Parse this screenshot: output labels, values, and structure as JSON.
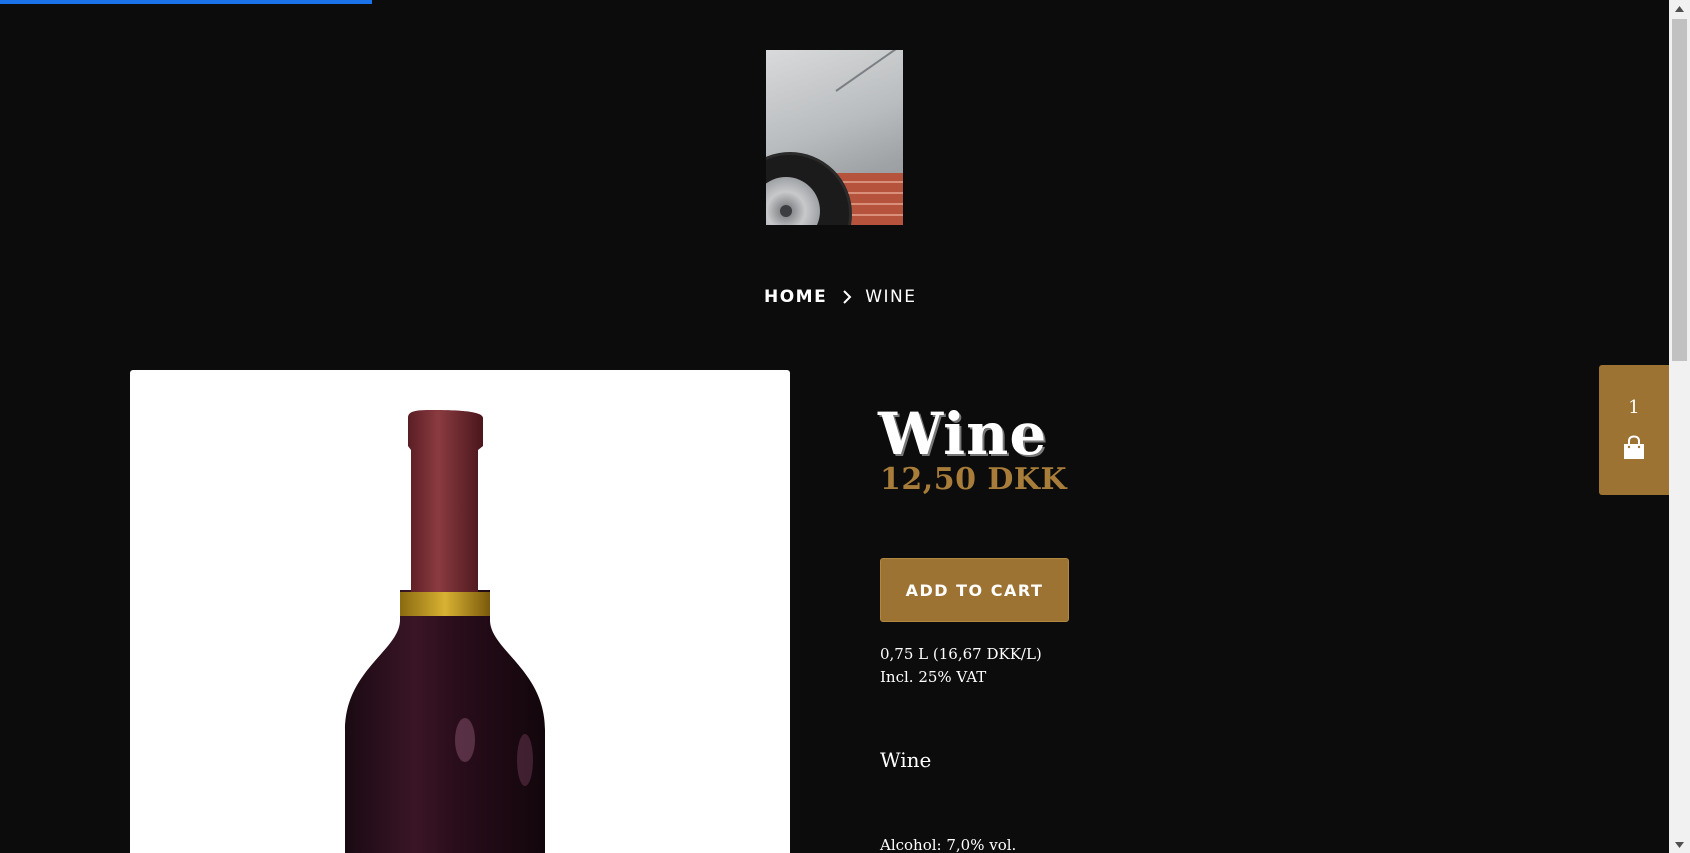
{
  "page_load_progress": 0.22,
  "logo": {
    "icon": "car-photo-logo"
  },
  "breadcrumb": {
    "home_label": "HOME",
    "separator_icon": "chevron-right-icon",
    "current_label": "WINE"
  },
  "product": {
    "title": "Wine",
    "price": "12,50 DKK",
    "add_to_cart_label": "ADD TO CART",
    "unit_price": "0,75 L (16,67 DKK/L)",
    "vat_note": "Incl. 25% VAT",
    "description_heading": "Wine",
    "alcohol": "Alcohol: 7,0% vol.",
    "image_icon": "wine-bottle-photo"
  },
  "cart": {
    "count": "1",
    "icon": "shopping-bag-icon"
  },
  "colors": {
    "background": "#0c0c0c",
    "accent": "#9c7333",
    "price": "#a87d3a",
    "progress": "#1a73e8"
  }
}
